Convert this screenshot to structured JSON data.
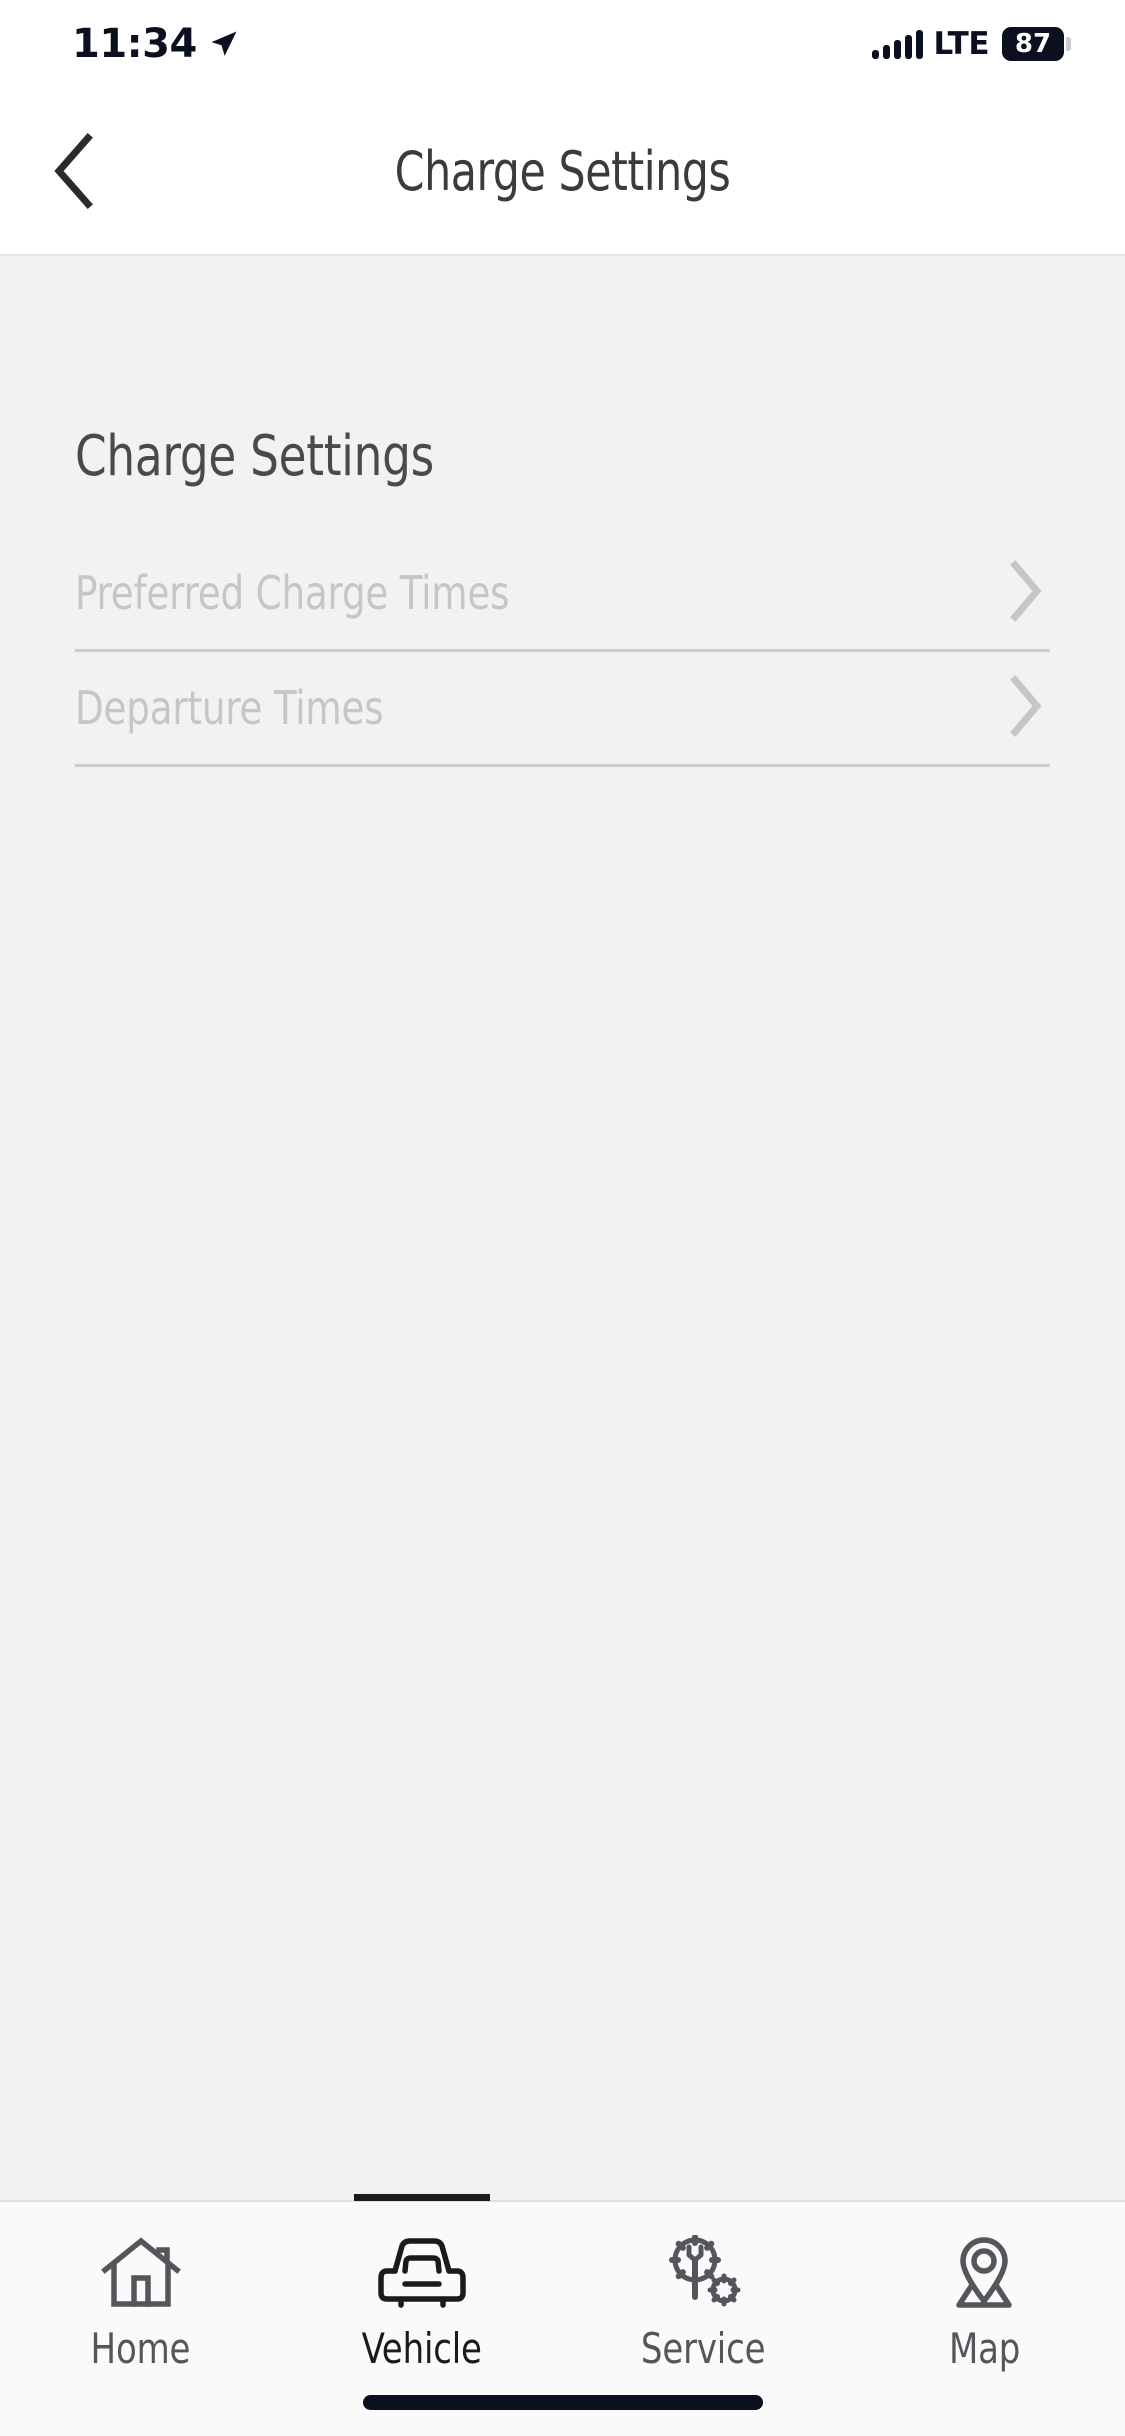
{
  "status_bar": {
    "time": "11:34",
    "location_icon": "location-arrow-icon",
    "signal_icon": "cellular-signal-icon",
    "network": "LTE",
    "battery_percent": "87"
  },
  "nav_header": {
    "back_icon": "chevron-left-icon",
    "title": "Charge Settings"
  },
  "main": {
    "heading": "Charge Settings",
    "rows": [
      {
        "label": "Preferred Charge Times",
        "chevron": "chevron-right-icon"
      },
      {
        "label": "Departure Times",
        "chevron": "chevron-right-icon"
      }
    ]
  },
  "tab_bar": {
    "items": [
      {
        "label": "Home",
        "icon": "home-icon",
        "active": false
      },
      {
        "label": "Vehicle",
        "icon": "car-icon",
        "active": true
      },
      {
        "label": "Service",
        "icon": "gear-wrench-icon",
        "active": false
      },
      {
        "label": "Map",
        "icon": "map-pin-icon",
        "active": false
      }
    ]
  },
  "colors": {
    "header_background": "#ffffff",
    "content_background": "#f2f2f2",
    "tabbar_background": "#fafafa",
    "title_text": "#3b3b3d",
    "disabled_text": "#c6c6c6",
    "divider": "#cdcdcd",
    "active_indicator": "#1b1b1d",
    "status_dark": "#0b1020"
  }
}
